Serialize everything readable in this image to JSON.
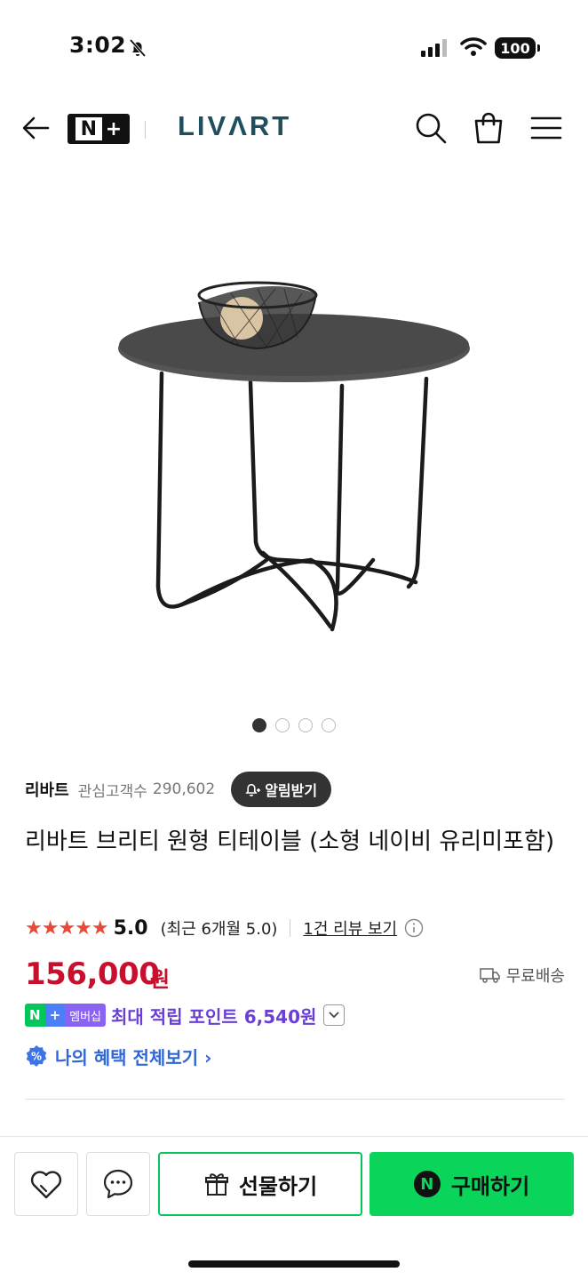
{
  "status_bar": {
    "time": "3:02",
    "battery": "100"
  },
  "header": {
    "nplus_n": "N",
    "nplus_plus": "+",
    "brand": "LIVΛRT"
  },
  "carousel": {
    "total": 4,
    "active_index": 1
  },
  "store": {
    "name": "리바트",
    "followers_label": "관심고객수",
    "followers_count": "290,602",
    "alarm_label": "알림받기"
  },
  "product": {
    "title": "리바트 브리티 원형 티테이블 (소형 네이비 유리미포함)"
  },
  "rating": {
    "stars": "★★★★★",
    "score": "5.0",
    "recent": "(최근 6개월 5.0)",
    "review_link": "1건 리뷰 보기"
  },
  "price": {
    "amount": "156,000",
    "unit": "원",
    "shipping": "무료배송"
  },
  "points": {
    "badge_n": "N",
    "badge_plus": "+",
    "badge_member": "멤버십",
    "text": "최대 적립 포인트 6,540원"
  },
  "benefits": {
    "link": "나의 혜택 전체보기 ›"
  },
  "bottom_bar": {
    "gift_label": "선물하기",
    "buy_n": "N",
    "buy_label": "구매하기"
  },
  "colors": {
    "price_red": "#c8102e",
    "naver_green": "#03c75a",
    "points_purple": "#6a3fd6",
    "link_blue": "#3166d8",
    "brand_teal": "#1f4e5f"
  }
}
